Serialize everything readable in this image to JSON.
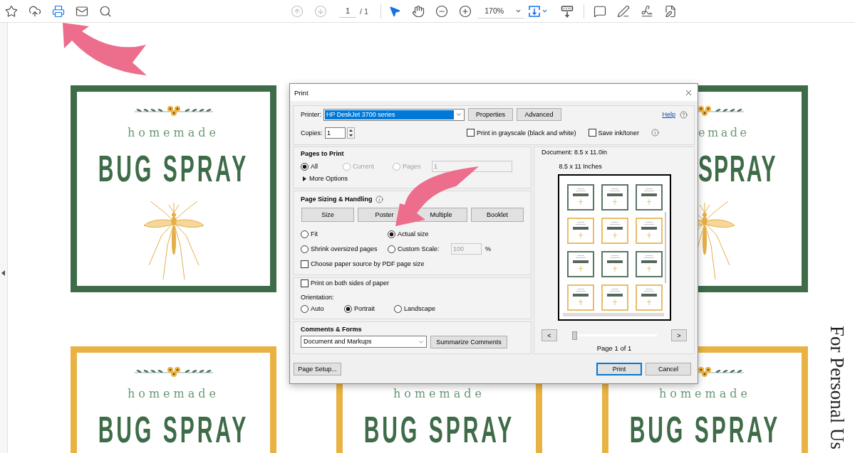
{
  "toolbar": {
    "tools": [
      {
        "kind": "star",
        "active": false
      },
      {
        "kind": "upload",
        "active": false
      },
      {
        "kind": "print",
        "active": true
      },
      {
        "kind": "mail",
        "active": false
      },
      {
        "kind": "find",
        "active": false
      }
    ],
    "page_nav": [
      {
        "kind": "previous",
        "disabled": true
      },
      {
        "kind": "next",
        "disabled": true
      }
    ],
    "page": "1",
    "page_total": "/ 1",
    "view_tools": [
      {
        "kind": "select",
        "active": true
      },
      {
        "kind": "hand",
        "active": false
      },
      {
        "kind": "zoom-out",
        "active": false
      },
      {
        "kind": "zoom-in",
        "active": false
      }
    ],
    "zoom": "170%",
    "layout_tools": [
      {
        "kind": "fit-page",
        "active": true
      },
      {
        "kind": "scroll-mode",
        "active": false
      }
    ],
    "annotate_tools": [
      {
        "kind": "comment",
        "active": false
      },
      {
        "kind": "highlight",
        "active": false
      },
      {
        "kind": "sign",
        "active": false
      },
      {
        "kind": "edit",
        "active": false
      }
    ]
  },
  "document": {
    "labels": [
      {
        "color": "#3e6b48",
        "subtitle": "homemade",
        "title": "BUG SPRAY"
      },
      {
        "color": "#3e6b48",
        "subtitle": "emade",
        "title": "SPRAY"
      },
      {
        "color": "#e9b343",
        "subtitle": "homemade",
        "title": "BUG SPRAY"
      },
      {
        "color": "#e9b343",
        "subtitle": "homemade",
        "title": "BUG SPRAY"
      },
      {
        "color": "#e9b343",
        "subtitle": "homemade",
        "title": "BUG SPRAY"
      }
    ],
    "margin_text": "For Personal Us"
  },
  "print_dialog": {
    "title": "Print",
    "printer_label": "Printer:",
    "printer": "HP DeskJet 3700 series",
    "printer_buttons": [
      "Properties",
      "Advanced"
    ],
    "help": "Help",
    "copies_label": "Copies:",
    "copies": "1",
    "options": [
      {
        "label": "Print in grayscale (black and white)",
        "checked": false
      },
      {
        "label": "Save ink/toner",
        "checked": false
      }
    ],
    "pages": {
      "heading": "Pages to Print",
      "choices": [
        {
          "label": "All",
          "selected": true,
          "disabled": false
        },
        {
          "label": "Current",
          "selected": false,
          "disabled": true
        },
        {
          "label": "Pages",
          "selected": false,
          "disabled": true
        }
      ],
      "range": {
        "value": "1",
        "disabled": true
      },
      "more": "More Options"
    },
    "sizing": {
      "heading": "Page Sizing & Handling",
      "modes": [
        "Size",
        "Poster",
        "Multiple",
        "Booklet"
      ],
      "choices": [
        {
          "label": "Fit",
          "selected": false
        },
        {
          "label": "Actual size",
          "selected": true
        },
        {
          "label": "Shrink oversized pages",
          "selected": false
        },
        {
          "label": "Custom Scale:",
          "selected": false
        }
      ],
      "scale": {
        "value": "100",
        "disabled": true
      },
      "unit": "%",
      "paper_source": {
        "label": "Choose paper source by PDF page size",
        "checked": false
      }
    },
    "duplex": {
      "label": "Print on both sides of paper",
      "checked": false
    },
    "orientation": {
      "label": "Orientation:",
      "choices": [
        {
          "label": "Auto",
          "selected": false
        },
        {
          "label": "Portrait",
          "selected": true
        },
        {
          "label": "Landscape",
          "selected": false
        }
      ]
    },
    "comments": {
      "heading": "Comments & Forms",
      "value": "Document and Markups",
      "button": "Summarize Comments"
    },
    "preview": {
      "document_size": "Document: 8.5 x 11.0in",
      "paper_size": "8.5 x 11 Inches",
      "thumbnails": [
        {
          "color": "#5a7564"
        },
        {
          "color": "#5a7564"
        },
        {
          "color": "#5a7564"
        },
        {
          "color": "#e8bd68"
        },
        {
          "color": "#e8bd68"
        },
        {
          "color": "#e8bd68"
        },
        {
          "color": "#5a7564"
        },
        {
          "color": "#5a7564"
        },
        {
          "color": "#5a7564"
        },
        {
          "color": "#e8bd68"
        },
        {
          "color": "#e8bd68"
        },
        {
          "color": "#e8bd68"
        }
      ],
      "previous": "<",
      "next": ">",
      "slider": {
        "level": 0
      },
      "page_label": "Page 1 of 1"
    },
    "page_setup": "Page Setup...",
    "actions": [
      {
        "label": "Print",
        "default": true
      },
      {
        "label": "Cancel",
        "default": false
      }
    ]
  }
}
